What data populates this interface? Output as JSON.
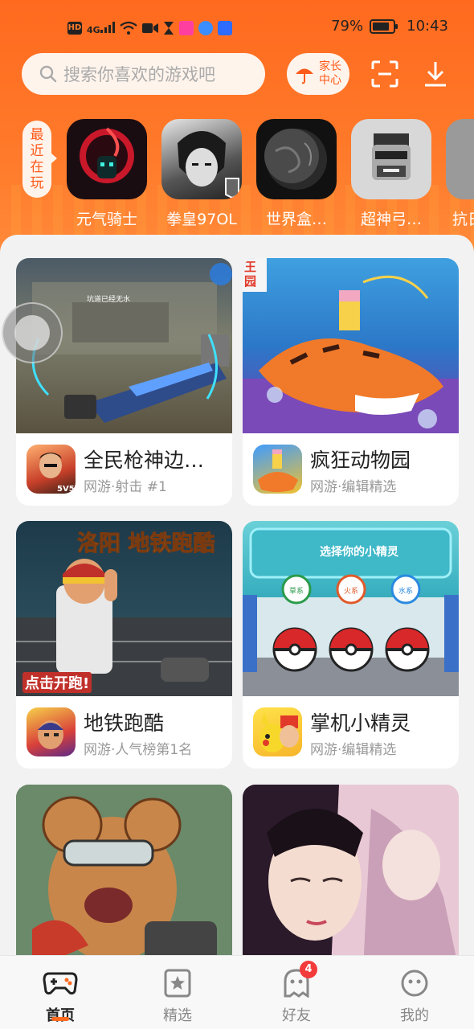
{
  "status_bar": {
    "left_tags": [
      "HD",
      "4G"
    ],
    "battery": "79%",
    "time": "10:43"
  },
  "search": {
    "placeholder": "搜索你喜欢的游戏吧"
  },
  "parent_center": {
    "line1": "家长",
    "line2": "中心"
  },
  "recent": {
    "tag_chars": [
      "最",
      "近",
      "在",
      "玩"
    ],
    "items": [
      {
        "name": "元气骑士",
        "icon": "soul-knight-icon"
      },
      {
        "name": "拳皇97OL",
        "icon": "kof97ol-icon"
      },
      {
        "name": "世界盒…",
        "icon": "worldbox-icon"
      },
      {
        "name": "超神弓…",
        "icon": "archer-icon"
      },
      {
        "name": "抗日",
        "icon": "partial-game-icon"
      }
    ]
  },
  "cards": [
    {
      "title": "全民枪神边…",
      "subtitle": "网游·射击 #1",
      "banner_text": "坑道已经无水"
    },
    {
      "title": "疯狂动物园",
      "subtitle": "网游·编辑精选",
      "banner_text": "王园"
    },
    {
      "title": "地铁跑酷",
      "subtitle": "网游·人气榜第1名",
      "banner_text": "洛阳 地铁跑酷",
      "banner_text2": "点击开跑!"
    },
    {
      "title": "掌机小精灵",
      "subtitle": "网游·编辑精选",
      "banner_text": "选择你的小精灵",
      "choices": [
        "草系",
        "火系",
        "水系"
      ]
    },
    {
      "title": "",
      "subtitle": ""
    },
    {
      "title": "",
      "subtitle": ""
    }
  ],
  "nav": {
    "items": [
      {
        "label": "首页",
        "icon": "gamepad-icon"
      },
      {
        "label": "精选",
        "icon": "star-bookmark-icon"
      },
      {
        "label": "好友",
        "icon": "ghost-friends-icon",
        "badge": "4"
      },
      {
        "label": "我的",
        "icon": "profile-face-icon"
      }
    ]
  },
  "colors": {
    "accent": "#ff6a1f",
    "badge": "#f33b3b"
  }
}
